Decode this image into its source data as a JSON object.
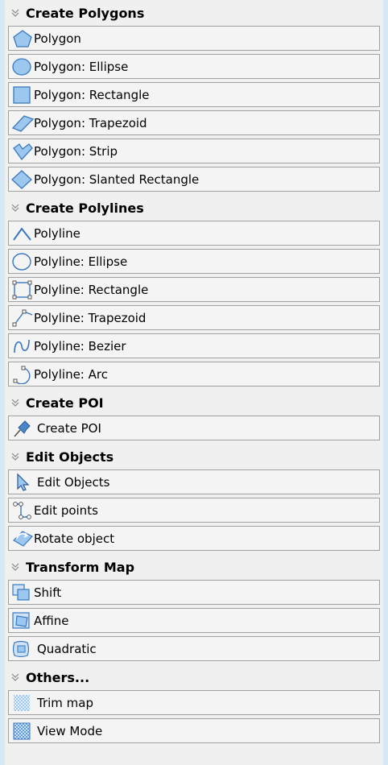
{
  "sections": [
    {
      "title": "Create Polygons",
      "items": [
        {
          "label": "Polygon",
          "icon": "pentagon-icon"
        },
        {
          "label": "Polygon: Ellipse",
          "icon": "ellipse-filled-icon"
        },
        {
          "label": "Polygon: Rectangle",
          "icon": "rectangle-filled-icon"
        },
        {
          "label": "Polygon: Trapezoid",
          "icon": "trapezoid-filled-icon"
        },
        {
          "label": "Polygon: Strip",
          "icon": "strip-filled-icon"
        },
        {
          "label": "Polygon: Slanted Rectangle",
          "icon": "diamond-filled-icon"
        }
      ]
    },
    {
      "title": "Create Polylines",
      "items": [
        {
          "label": "Polyline",
          "icon": "polyline-icon"
        },
        {
          "label": "Polyline: Ellipse",
          "icon": "ellipse-outline-icon"
        },
        {
          "label": "Polyline: Rectangle",
          "icon": "rectangle-outline-icon"
        },
        {
          "label": "Polyline: Trapezoid",
          "icon": "trapezoid-outline-icon"
        },
        {
          "label": "Polyline: Bezier",
          "icon": "bezier-icon"
        },
        {
          "label": "Polyline: Arc",
          "icon": "arc-icon"
        }
      ]
    },
    {
      "title": "Create POI",
      "items": [
        {
          "label": "Create POI",
          "icon": "pushpin-icon"
        }
      ]
    },
    {
      "title": "Edit Objects",
      "items": [
        {
          "label": "Edit Objects",
          "icon": "cursor-arrow-icon"
        },
        {
          "label": "Edit points",
          "icon": "edit-points-icon"
        },
        {
          "label": "Rotate object",
          "icon": "rotate-icon"
        }
      ]
    },
    {
      "title": "Transform Map",
      "items": [
        {
          "label": "Shift",
          "icon": "shift-icon"
        },
        {
          "label": "Affine",
          "icon": "affine-icon"
        },
        {
          "label": "Quadratic",
          "icon": "quadratic-icon"
        }
      ]
    },
    {
      "title": "Others...",
      "items": [
        {
          "label": "Trim map",
          "icon": "trim-map-icon"
        },
        {
          "label": "View Mode",
          "icon": "view-mode-icon"
        }
      ]
    }
  ]
}
